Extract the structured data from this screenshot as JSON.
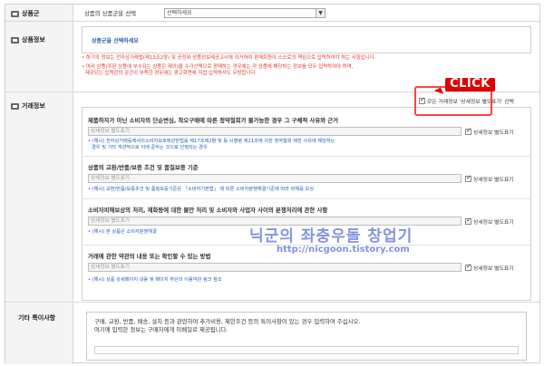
{
  "rows": {
    "category": {
      "label": "상품군",
      "select_caption": "상품의 상품군을 선택",
      "select_value": "선택하세요"
    },
    "product_info": {
      "label": "상품정보",
      "select_prompt": "상품군을 선택하세요",
      "notice_1": "• 하기의 정보는 전자상거래법(제13조2항) 및 공정위 상품정보제공고시에 의거하여 판매회원이 스스로의 책임으로 입력하여야 하는 사항입니다.",
      "notice_2": "• 여러 상품(주된 상품에 부수되는 상품은 제외)을 수가선택으로 판매하는 경우에는 각 상품에 해당하는 정보를 모두 입력하여야 하며,",
      "notice_3": "제공되는 입력란의 공간이 부족한 경우에는 광고화면에 직접 입력하셔도 무방합니다."
    },
    "trade_info": {
      "label": "거래정보",
      "all_checkbox_label": "모든 거래정보 '상세정보 별도표기' 선택",
      "sections": [
        {
          "question": "제품하자가 아닌 소비자의 단순변심, 착오구매에 따른 청약철회가 불가능한 경우 그 구체적 사유와 근거",
          "input_placeholder": "상세정보 별도표기",
          "checkbox_label": "상세정보 별도표기",
          "note_1": "• (예시) 전자상거래등에서의소비자보호에관한법률 제17조제2항 및 동 시행령 제21조에 의한 청약철회 제한 사유에 해당하는",
          "note_2": "경우 및 기타 객관적으로 이에 준하는 것으로 인정되는 경우"
        },
        {
          "question": "상품의 교환/반품/보증 조건 및 품질보증 기준",
          "input_placeholder": "상세정보 별도표기",
          "checkbox_label": "상세정보 별도표기",
          "note_1": "• (예시) 교환/반품/보증조건 및 품질보증기준은 「소비자기본법」 에 따른 소비자분쟁해결기준에 따라 피해를 보상"
        },
        {
          "question": "소비자피해보상의 처리, 재화등에 대한 불만 처리 및 소비자와 사업자 사이의 분쟁처리에 관한 사항",
          "input_placeholder": "상세정보 별도표기",
          "checkbox_label": "상세정보 별도표기",
          "note_1": "• (예시) 본 상품은 소비자분쟁해결"
        },
        {
          "question": "거래에 관한 약관의 내용 또는 확인할 수 있는 방법",
          "input_placeholder": "상세정보 별도표기",
          "checkbox_label": "상세정보 별도표기",
          "note_1": "• (예시) 상품 상세페이지 내용 및 페이지 하단의 이용약관 링크 참조"
        }
      ]
    },
    "other": {
      "label": "기타 특이사항",
      "text_1": "구매, 교환, 반품, 배송, 설치 등과 관련하여 추가비용, 제한조건 등의 특이사항이 있는 경우 입력하여 주십시오.",
      "text_2": "여기에 입력한 정보는 구매자에게 미배일로 제공됩니다."
    }
  },
  "overlay": {
    "click_label": "CLICK",
    "watermark_title": "닉군의 좌충우돌 창업기",
    "watermark_url": "http://nicgoon.tistory.com"
  },
  "colors": {
    "notice_red": "#e8352c",
    "note_blue": "#2060b8",
    "click_red": "#e30000",
    "watermark": "#5a6ed8"
  }
}
